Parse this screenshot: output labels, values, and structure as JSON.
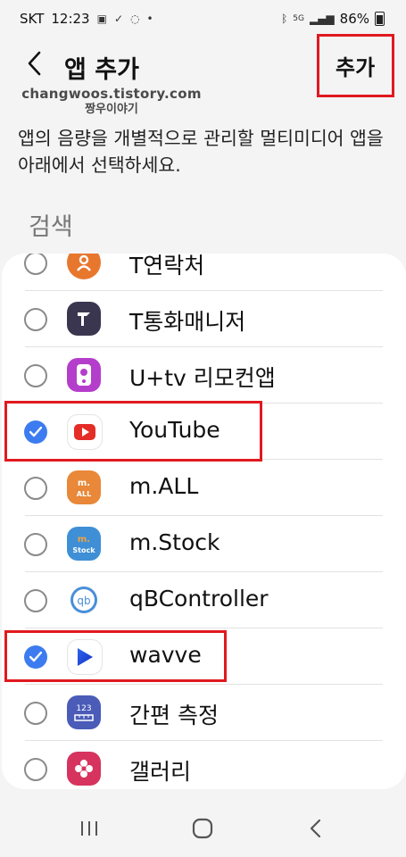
{
  "status_bar": {
    "carrier": "SKT",
    "time": "12:23",
    "network": "5G",
    "battery": "86%"
  },
  "header": {
    "title": "앱 추가",
    "add_label": "추가"
  },
  "watermark": {
    "url": "changwoos.tistory.com",
    "name": "짱우이야기"
  },
  "description": "앱의 음량을 개별적으로 관리할 멀티미디어 앱을 아래에서 선택하세요.",
  "search_label": "검색",
  "apps": [
    {
      "label": "T연락처",
      "icon": "t-contacts-icon",
      "checked": false
    },
    {
      "label": "T통화매니저",
      "icon": "t-call-manager-icon",
      "checked": false
    },
    {
      "label": "U+tv 리모컨앱",
      "icon": "remote-control-icon",
      "checked": false
    },
    {
      "label": "YouTube",
      "icon": "youtube-icon",
      "checked": true
    },
    {
      "label": "m.ALL",
      "icon": "m-all-icon",
      "checked": false
    },
    {
      "label": "m.Stock",
      "icon": "m-stock-icon",
      "checked": false
    },
    {
      "label": "qBController",
      "icon": "qbcontroller-icon",
      "checked": false
    },
    {
      "label": "wavve",
      "icon": "wavve-icon",
      "checked": true
    },
    {
      "label": "간편 측정",
      "icon": "measure-icon",
      "checked": false
    },
    {
      "label": "갤러리",
      "icon": "gallery-icon",
      "checked": false
    }
  ],
  "colors": {
    "accent": "#3d7cf0",
    "highlight": "#e0191f",
    "background": "#f4f4f4"
  }
}
